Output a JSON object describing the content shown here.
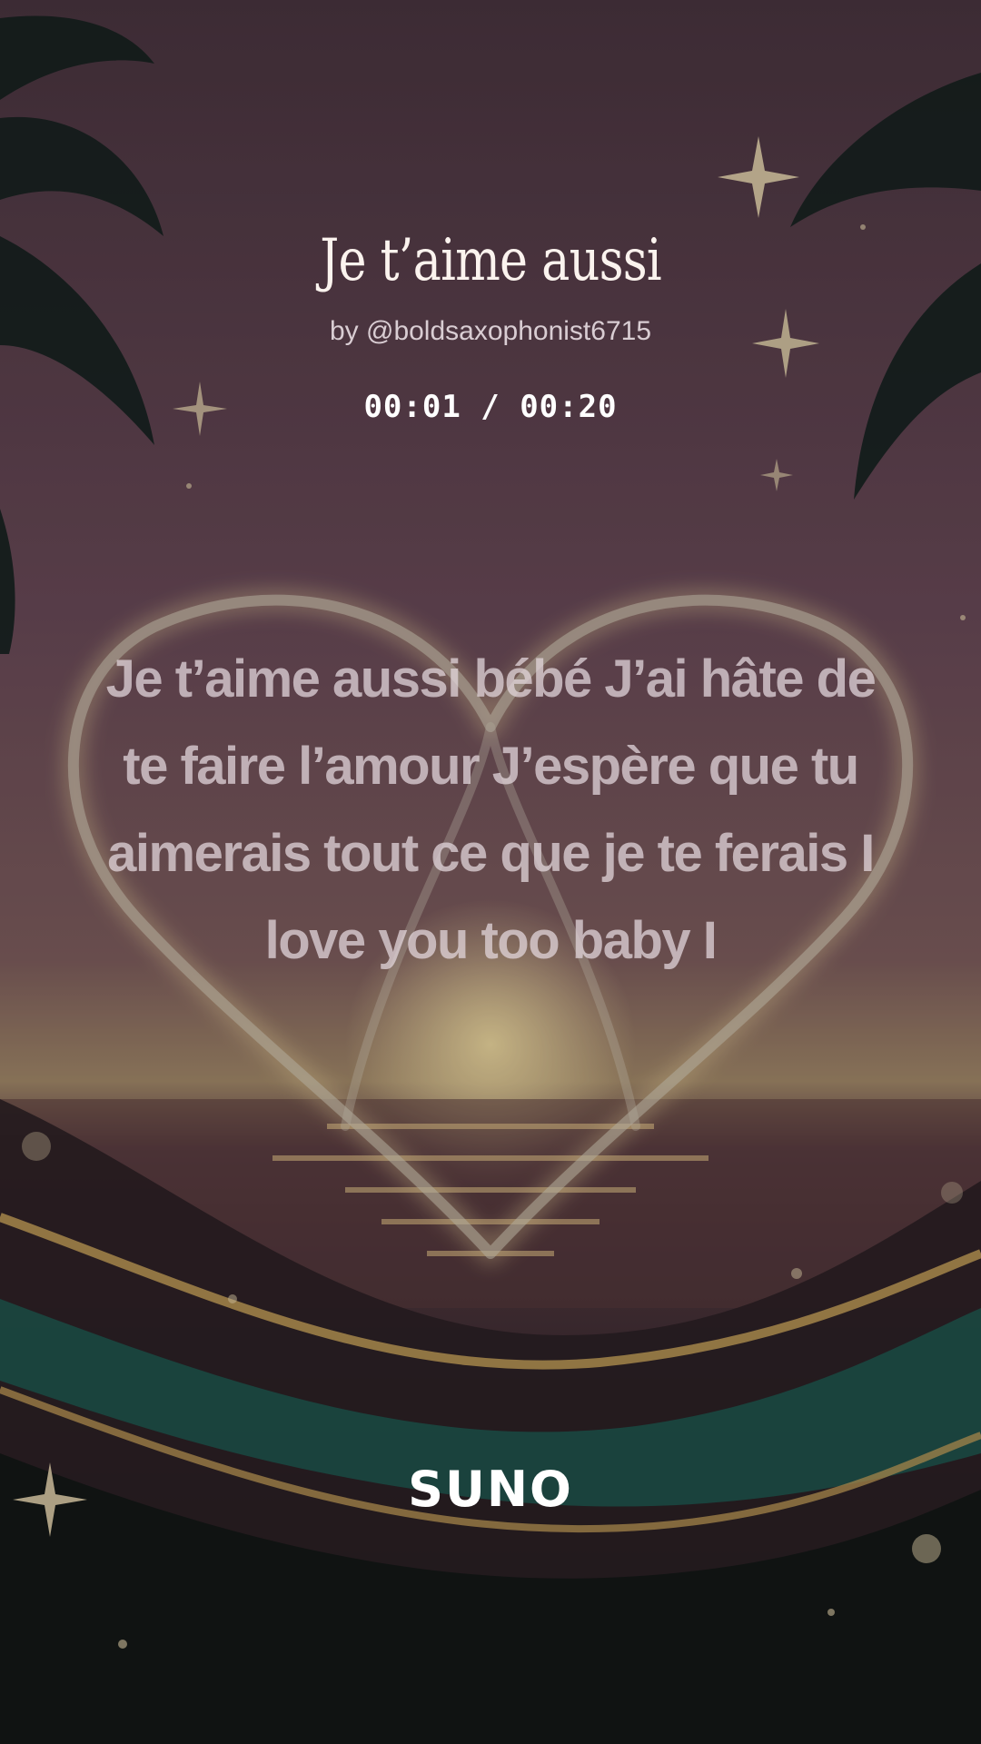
{
  "song": {
    "title": "Je t’aime aussi",
    "artist": "by @boldsaxophonist6715",
    "time": "00:01 / 00:20"
  },
  "lyrics": {
    "text": "Je t’aime aussi bébé J’ai hâte de te faire l’amour J’espère que tu aimerais tout ce que je te ferais I love you too baby I"
  },
  "branding": {
    "logo": "SUNO"
  },
  "background": {
    "icons": [
      "palm-leaf-icon",
      "sparkle-star-icon",
      "neon-heart-icon",
      "sunset-icon",
      "ocean-waves-icon"
    ],
    "colors": {
      "sky": "#5a3f4c",
      "glow": "#e8c98a",
      "wave_teal": "#1f5a52",
      "wave_gold": "#c8a25a",
      "night": "#121514"
    }
  }
}
